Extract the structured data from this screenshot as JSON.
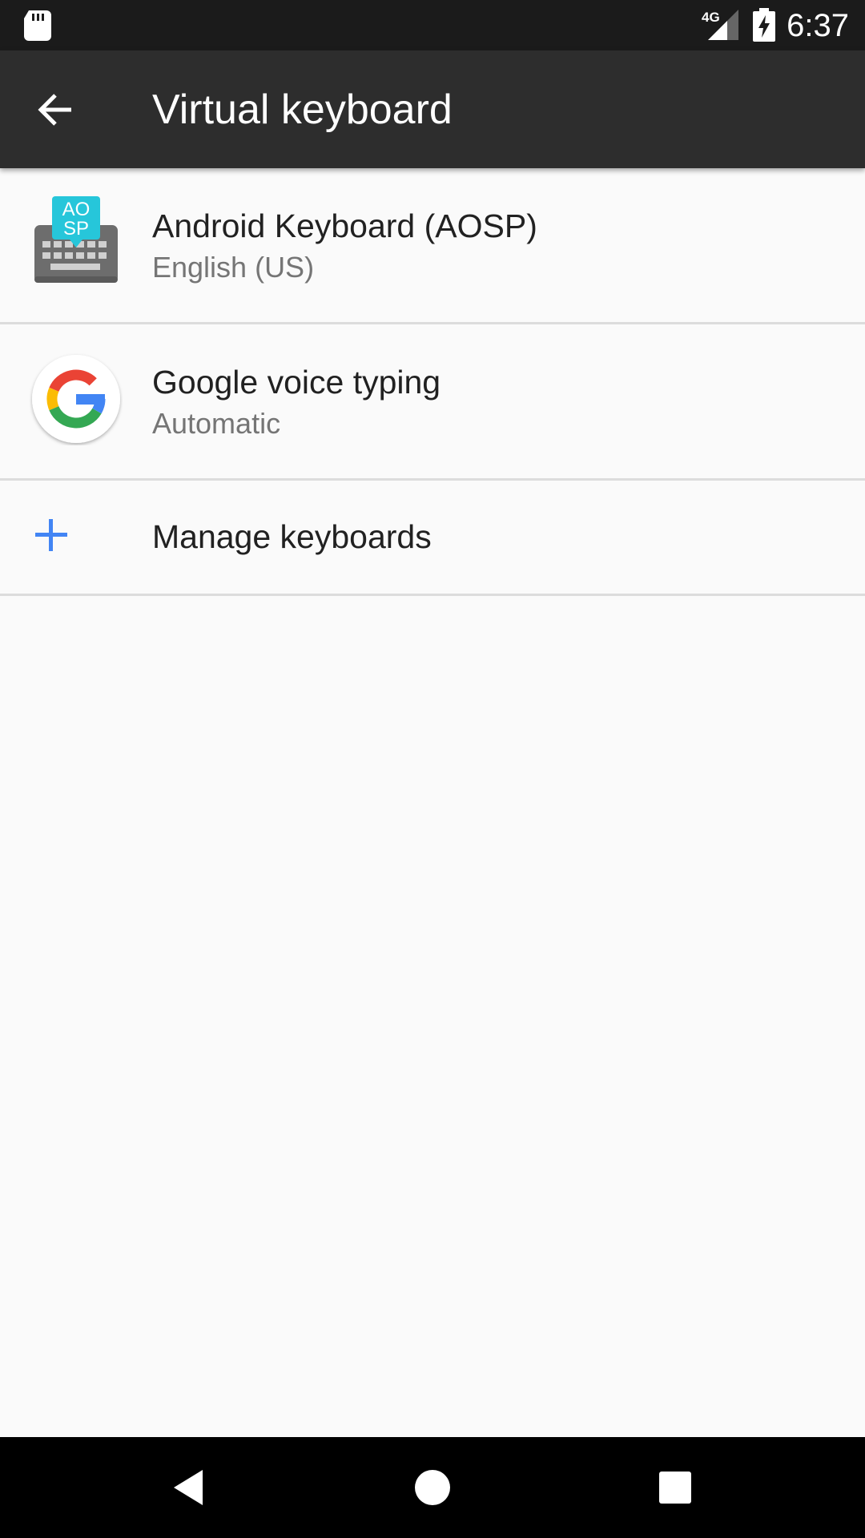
{
  "status_bar": {
    "network_type": "4G",
    "time": "6:37",
    "icons": [
      "sd-card-icon",
      "signal-icon",
      "battery-charging-icon"
    ]
  },
  "app_bar": {
    "title": "Virtual keyboard",
    "back_icon": "arrow-back-icon"
  },
  "keyboards": [
    {
      "title": "Android Keyboard (AOSP)",
      "subtitle": "English (US)",
      "icon": "aosp-keyboard-icon",
      "icon_badge_line1": "AO",
      "icon_badge_line2": "SP"
    },
    {
      "title": "Google voice typing",
      "subtitle": "Automatic",
      "icon": "google-logo-icon"
    }
  ],
  "manage": {
    "label": "Manage keyboards",
    "icon": "plus-icon"
  },
  "nav_bar": {
    "buttons": [
      "back-triangle-icon",
      "home-circle-icon",
      "recents-square-icon"
    ]
  },
  "colors": {
    "status_bar": "#1b1b1b",
    "app_bar": "#2d2d2d",
    "background": "#fafafa",
    "accent": "#4285f4",
    "divider": "#dcdcdc"
  }
}
